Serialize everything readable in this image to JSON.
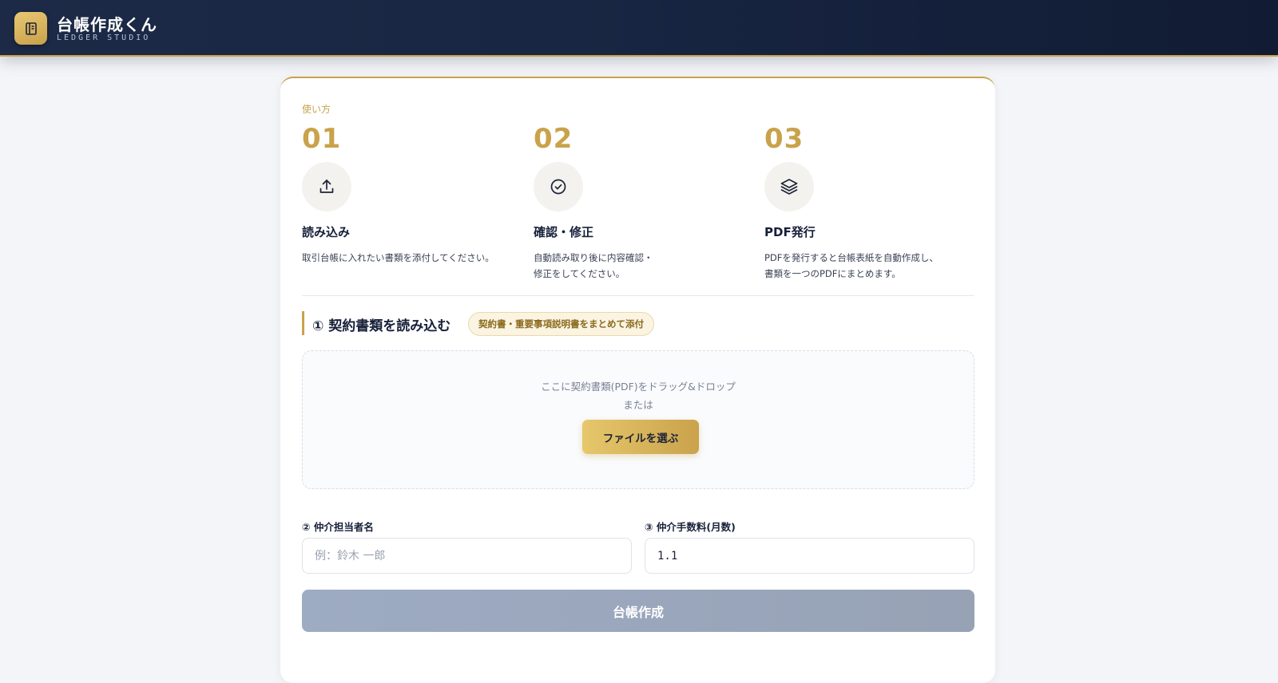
{
  "header": {
    "title": "台帳作成くん",
    "subtitle": "LEDGER STUDIO",
    "logo_icon": "ledger-book-icon"
  },
  "howto": {
    "label": "使い方",
    "steps": [
      {
        "number": "01",
        "icon": "upload-icon",
        "title": "読み込み",
        "desc": "取引台帳に入れたい書類を添付してください。"
      },
      {
        "number": "02",
        "icon": "check-circle-icon",
        "title": "確認・修正",
        "desc": "自動読み取り後に内容確認・\n修正をしてください。"
      },
      {
        "number": "03",
        "icon": "layers-icon",
        "title": "PDF発行",
        "desc": "PDFを発行すると台帳表紙を自動作成し、\n書類を一つのPDFにまとめます。"
      }
    ]
  },
  "upload": {
    "title": "① 契約書類を読み込む",
    "badge": "契約書・重要事項説明書をまとめて添付",
    "drop_text": "ここに契約書類(PDF)をドラッグ&ドロップ",
    "or_text": "または",
    "button_label": "ファイルを選ぶ"
  },
  "form": {
    "agent_label": "② 仲介担当者名",
    "agent_placeholder": "例：鈴木 一郎",
    "agent_value": "",
    "fee_label": "③ 仲介手数料(月数)",
    "fee_value": "1.1"
  },
  "submit_label": "台帳作成",
  "colors": {
    "gold": "#c9a24a",
    "navy": "#1c2a47",
    "disabled_button": "#9aa6bc"
  }
}
